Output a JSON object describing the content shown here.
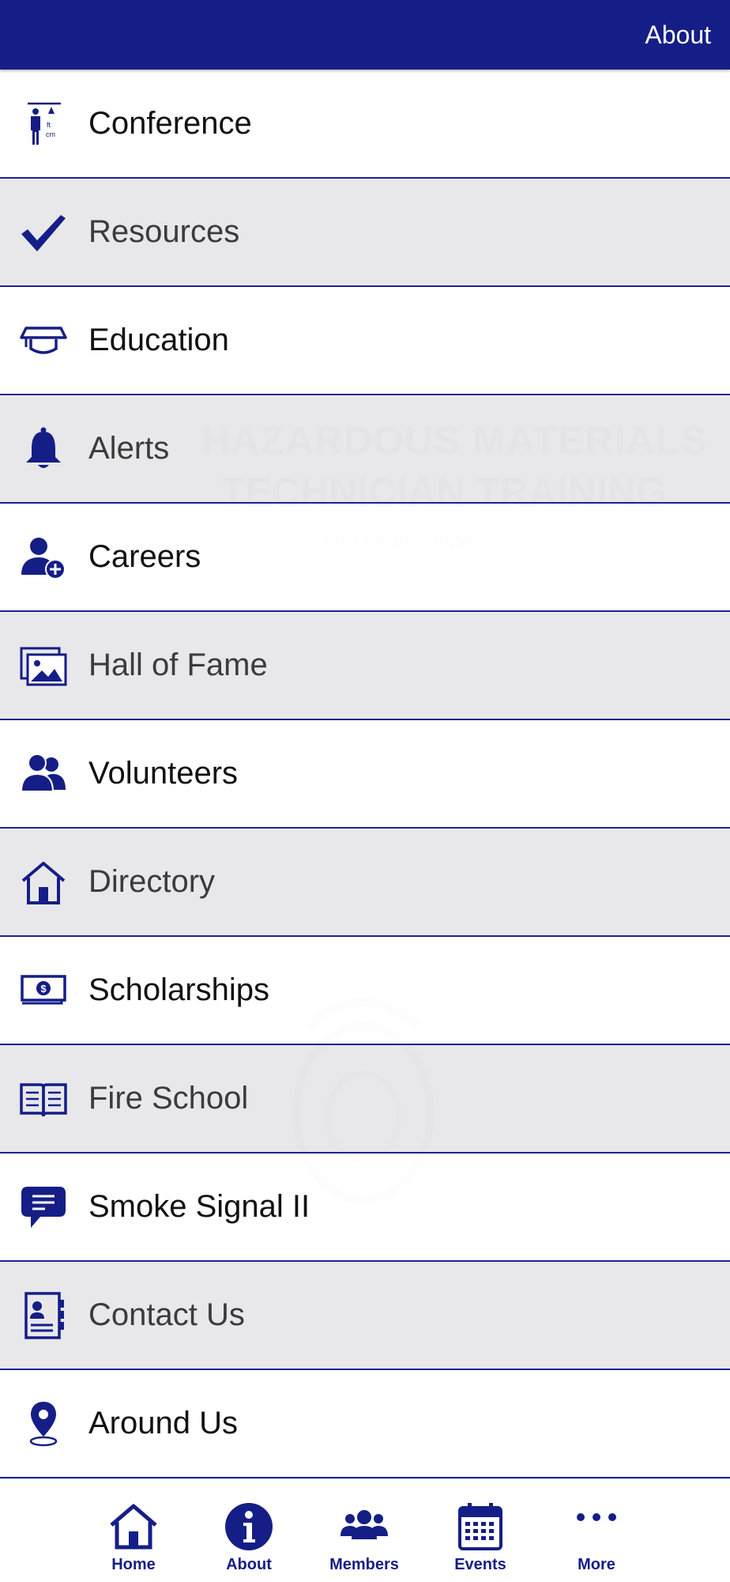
{
  "header": {
    "title": "About"
  },
  "background": {
    "line1": "HAZARDOUS MATERIALS",
    "line2": "TECHNICIAN TRAINING",
    "line3": "tion for the      onder"
  },
  "menu": {
    "items": [
      {
        "label": "Conference",
        "icon": "height-measure-person-icon"
      },
      {
        "label": "Resources",
        "icon": "checkmark-icon"
      },
      {
        "label": "Education",
        "icon": "graduation-cap-icon"
      },
      {
        "label": "Alerts",
        "icon": "bell-icon"
      },
      {
        "label": "Careers",
        "icon": "user-add-icon"
      },
      {
        "label": "Hall of Fame",
        "icon": "photo-gallery-icon"
      },
      {
        "label": "Volunteers",
        "icon": "users-icon"
      },
      {
        "label": "Directory",
        "icon": "house-icon"
      },
      {
        "label": "Scholarships",
        "icon": "money-bill-icon"
      },
      {
        "label": "Fire School",
        "icon": "open-book-icon"
      },
      {
        "label": "Smoke Signal II",
        "icon": "chat-bubble-icon"
      },
      {
        "label": "Contact Us",
        "icon": "contact-card-icon"
      },
      {
        "label": "Around Us",
        "icon": "map-pin-icon"
      }
    ]
  },
  "tabbar": {
    "tabs": [
      {
        "label": "Home",
        "icon": "home-icon"
      },
      {
        "label": "About",
        "icon": "info-icon"
      },
      {
        "label": "Members",
        "icon": "members-icon"
      },
      {
        "label": "Events",
        "icon": "calendar-icon"
      },
      {
        "label": "More",
        "icon": "more-dots-icon"
      }
    ]
  },
  "colors": {
    "brand": "#151e86",
    "divider": "#1b2591",
    "row_light": "#ffffff",
    "row_dark": "#e6e6e9"
  }
}
